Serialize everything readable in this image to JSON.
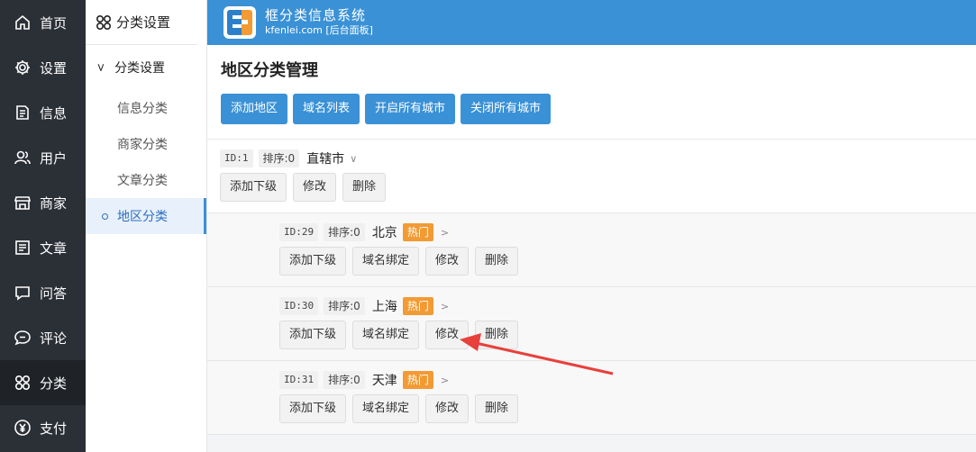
{
  "nav": [
    {
      "label": "首页",
      "icon": "home-icon"
    },
    {
      "label": "设置",
      "icon": "gear-icon"
    },
    {
      "label": "信息",
      "icon": "document-icon"
    },
    {
      "label": "用户",
      "icon": "users-icon"
    },
    {
      "label": "商家",
      "icon": "store-icon"
    },
    {
      "label": "文章",
      "icon": "article-icon"
    },
    {
      "label": "问答",
      "icon": "chat-icon"
    },
    {
      "label": "评论",
      "icon": "comment-icon"
    },
    {
      "label": "分类",
      "icon": "category-icon"
    },
    {
      "label": "支付",
      "icon": "yen-icon"
    }
  ],
  "sub": {
    "title": "分类设置",
    "group": "分类设置",
    "items": [
      "信息分类",
      "商家分类",
      "文章分类",
      "地区分类"
    ]
  },
  "header": {
    "title": "框分类信息系统",
    "subtitle": "kfenlei.com [后台面板]"
  },
  "main": {
    "page_title": "地区分类管理",
    "toolbar": [
      "添加地区",
      "域名列表",
      "开启所有城市",
      "关闭所有城市"
    ],
    "parent": {
      "id": "ID:1",
      "sort": "排序:0",
      "name": "直辖市",
      "caret": "∨",
      "buttons": [
        "添加下级",
        "修改",
        "删除"
      ]
    },
    "children": [
      {
        "id": "ID:29",
        "sort": "排序:0",
        "name": "北京",
        "hot": "热门",
        "caret": ">",
        "buttons": [
          "添加下级",
          "域名绑定",
          "修改",
          "删除"
        ]
      },
      {
        "id": "ID:30",
        "sort": "排序:0",
        "name": "上海",
        "hot": "热门",
        "caret": ">",
        "buttons": [
          "添加下级",
          "域名绑定",
          "修改",
          "删除"
        ]
      },
      {
        "id": "ID:31",
        "sort": "排序:0",
        "name": "天津",
        "hot": "热门",
        "caret": ">",
        "buttons": [
          "添加下级",
          "域名绑定",
          "修改",
          "删除"
        ]
      }
    ]
  },
  "colors": {
    "nav_bg": "#2b2f36",
    "header_bg": "#3a91d6",
    "hot": "#f29a33",
    "arrow": "#e8403b"
  }
}
